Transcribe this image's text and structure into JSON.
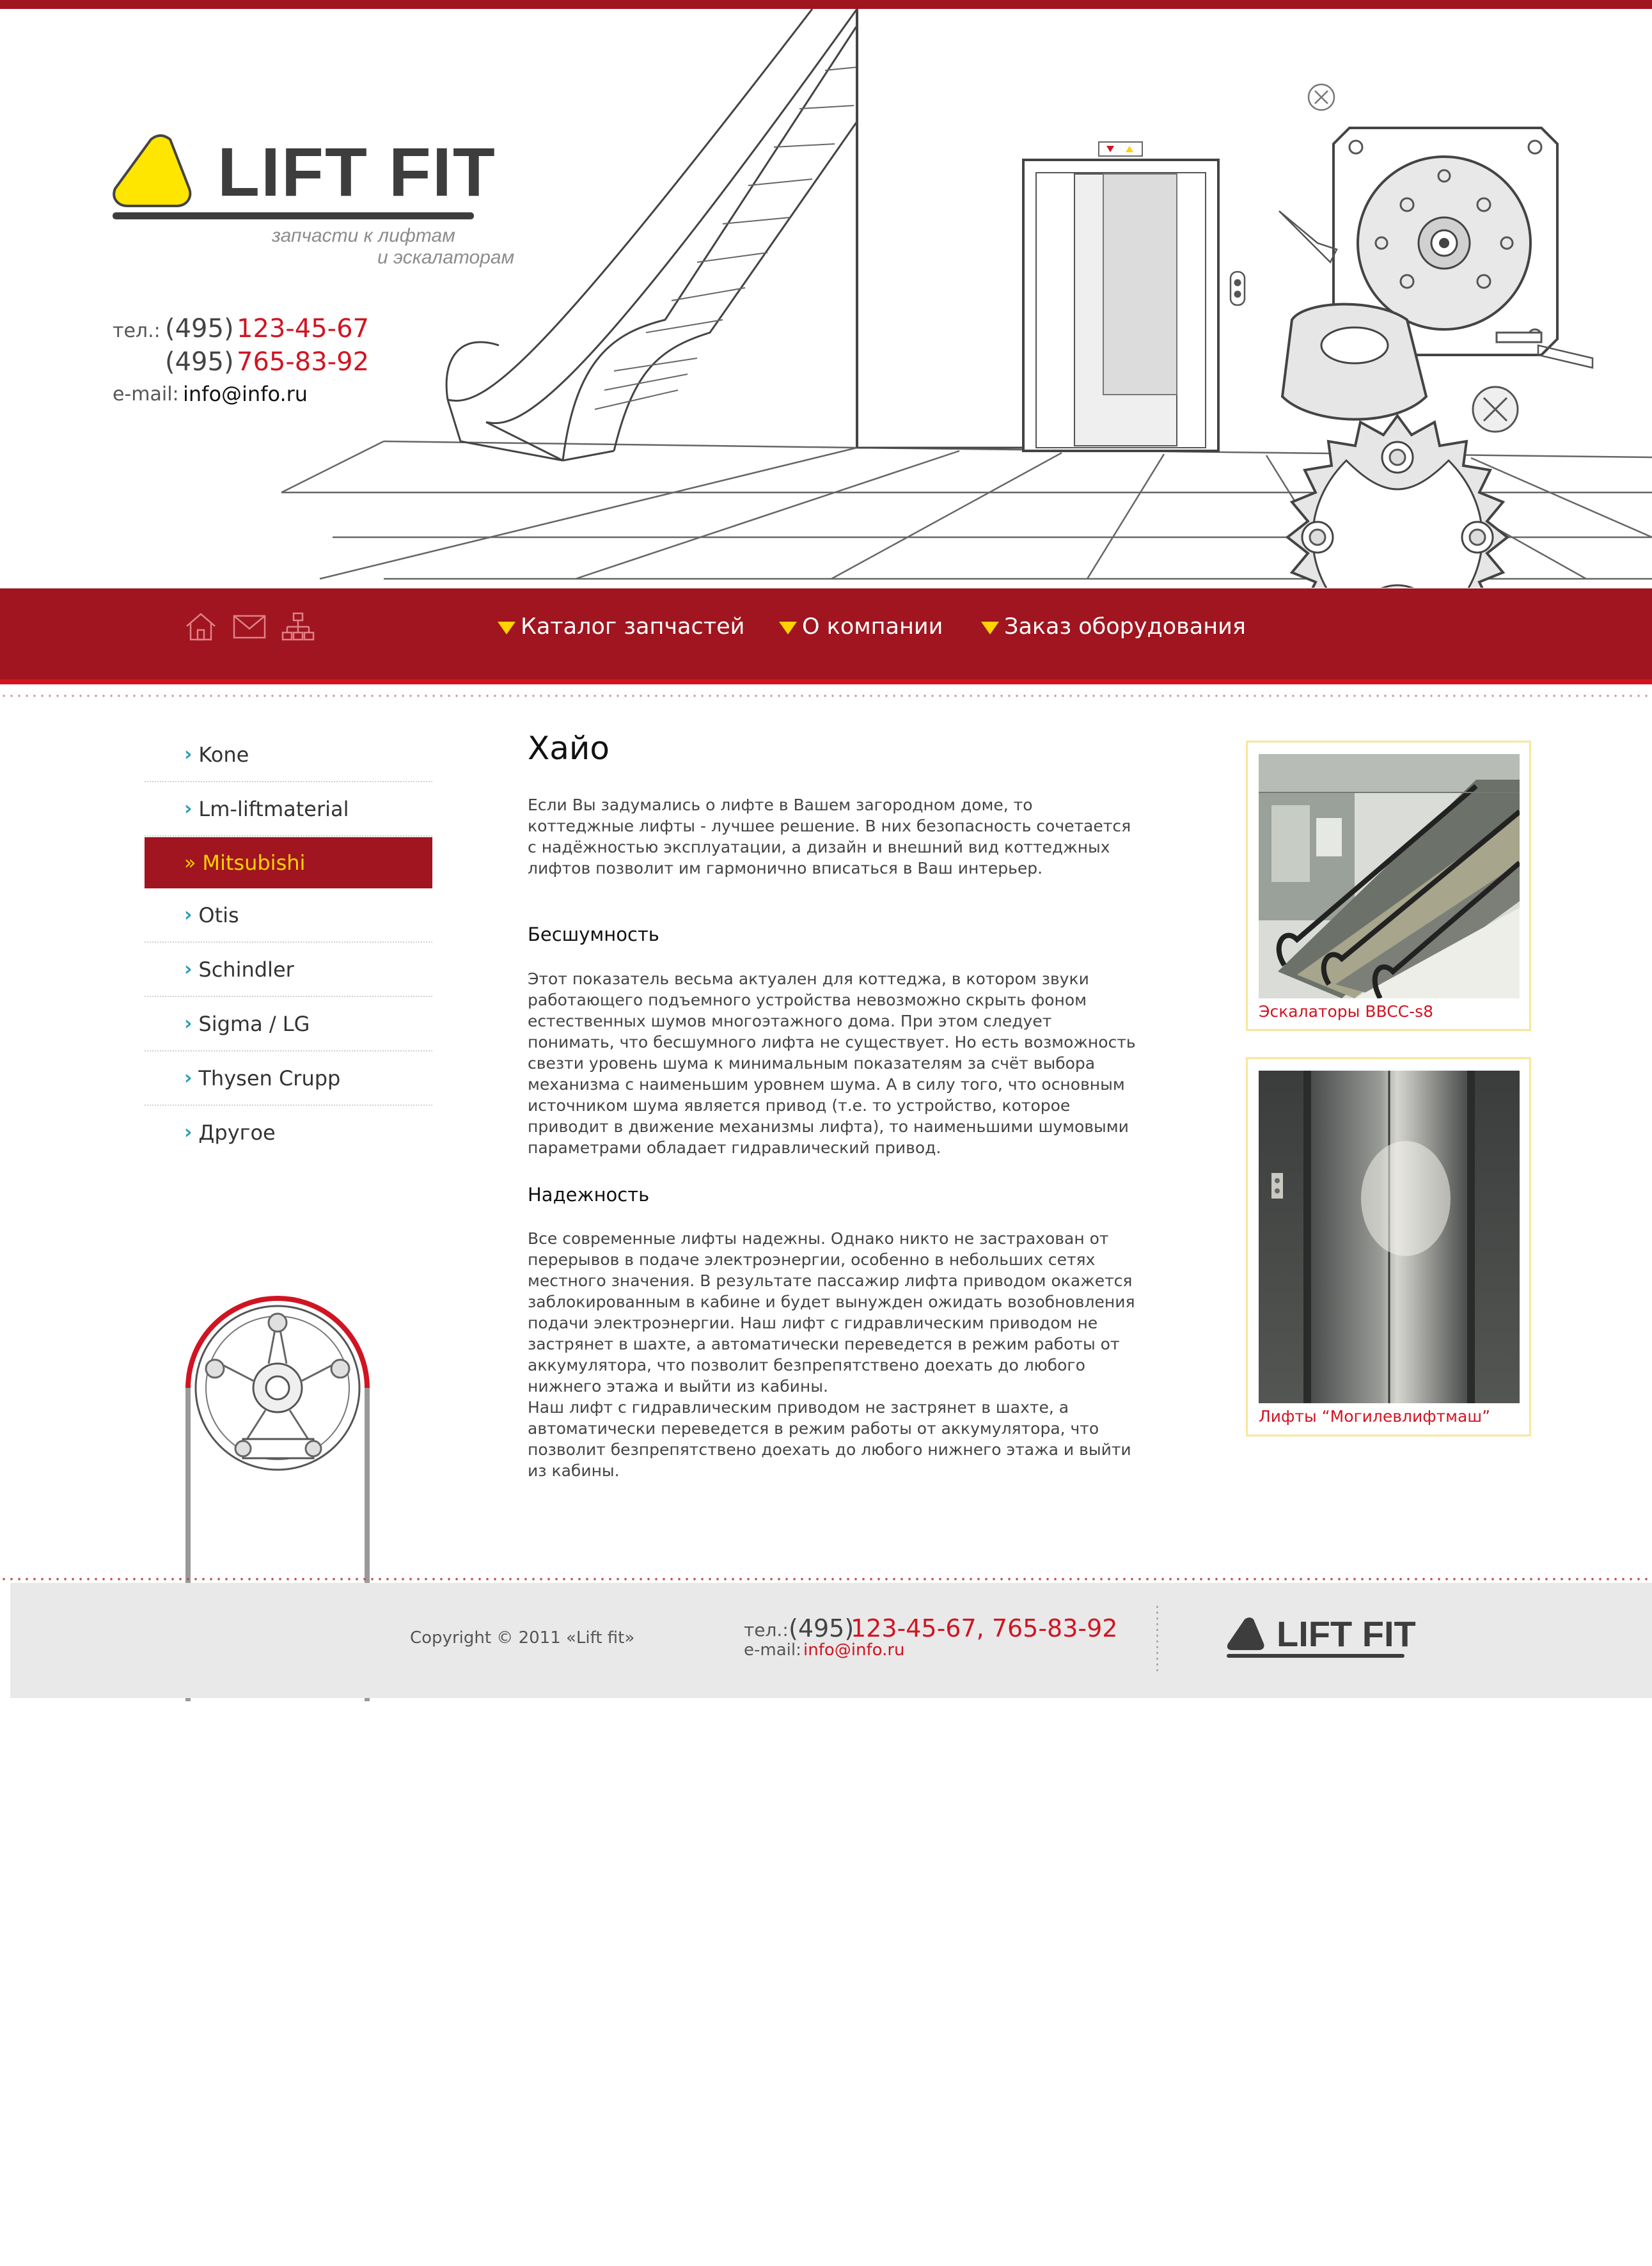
{
  "brand": {
    "name": "LIFT FIT",
    "tagline_line1": "запчасти к лифтам",
    "tagline_line2": "и эскалаторам"
  },
  "contacts": {
    "phone_label": "тел.:",
    "phone1_code": "(495)",
    "phone1_number": "123-45-67",
    "phone2_code": "(495)",
    "phone2_number": "765-83-92",
    "email_label": "e-mail:",
    "email": "info@info.ru"
  },
  "nav": {
    "icons": [
      "home-icon",
      "mail-icon",
      "sitemap-icon"
    ],
    "items": [
      {
        "label": "Каталог запчастей"
      },
      {
        "label": "О компании"
      },
      {
        "label": "Заказ оборудования"
      }
    ]
  },
  "sidebar": {
    "active_index": 2,
    "items": [
      {
        "label": "Kone"
      },
      {
        "label": "Lm-liftmaterial"
      },
      {
        "label": "Mitsubishi"
      },
      {
        "label": "Otis"
      },
      {
        "label": "Schindler"
      },
      {
        "label": "Sigma / LG"
      },
      {
        "label": "Thysen Crupp"
      },
      {
        "label": "Другое"
      }
    ]
  },
  "content": {
    "title": "Хайо",
    "intro": "Если Вы задумались о лифте в Вашем загородном доме, то коттеджные лифты - лучшее решение. В них безопасность сочетается с надёжностью эксплуатации, а дизайн и внешний вид коттеджных лифтов позволит им гармонично вписаться в Ваш интерьер.",
    "section1_title": "Бесшумность",
    "section1_text": "Этот показатель весьма актуален для коттеджа, в котором звуки работающего подъемного устройства невозможно скрыть фоном естественных шумов многоэтажного дома. При этом следует понимать, что бесшумного лифта не существует. Но есть возможность свезти уровень шума к минимальным показателям за счёт выбора механизма с наименьшим уровнем шума. А в силу того, что основным источником шума является привод (т.е. то устройство, которое приводит в движение механизмы лифта), то наименьшими шумовыми параметрами обладает гидравлический привод.",
    "section2_title": "Надежность",
    "section2_text": "Все современные лифты надежны. Однако никто не застрахован от перерывов в подаче электроэнергии, особенно в небольших сетях местного значения. В результате пассажир лифта приводом окажется заблокированным в кабине и будет вынужден ожидать возобновления подачи электроэнергии. Наш лифт с гидравлическим приводом не застрянет в шахте, а автоматически переведется в режим работы от аккумулятора, что позволит безпрепятствено доехать до любого нижнего этажа и выйти из кабины.",
    "section2_text_extra": "Наш лифт с гидравлическим приводом не застрянет в шахте, а автоматически переведется в режим работы от аккумулятора, что позволит безпрепятствено доехать до любого нижнего этажа и выйти из кабины."
  },
  "cards": [
    {
      "caption": "Эскалаторы BBCC-s8"
    },
    {
      "caption": "Лифты “Могилевлифтмаш”"
    }
  ],
  "footer": {
    "copyright": "Copyright © 2011 «Lift fit»",
    "phone_label": "тел.:",
    "phone_code": "(495)",
    "phone_numbers": "123-45-67, 765-83-92",
    "email_label": "e-mail:",
    "email": "info@info.ru",
    "logo_text": "LIFT FIT"
  },
  "colors": {
    "brand_red": "#a0151f",
    "accent_red": "#d11422",
    "logo_yellow": "#ffe600",
    "highlight_yellow": "#ffd200",
    "chevron_blue": "#2a9bb6"
  }
}
